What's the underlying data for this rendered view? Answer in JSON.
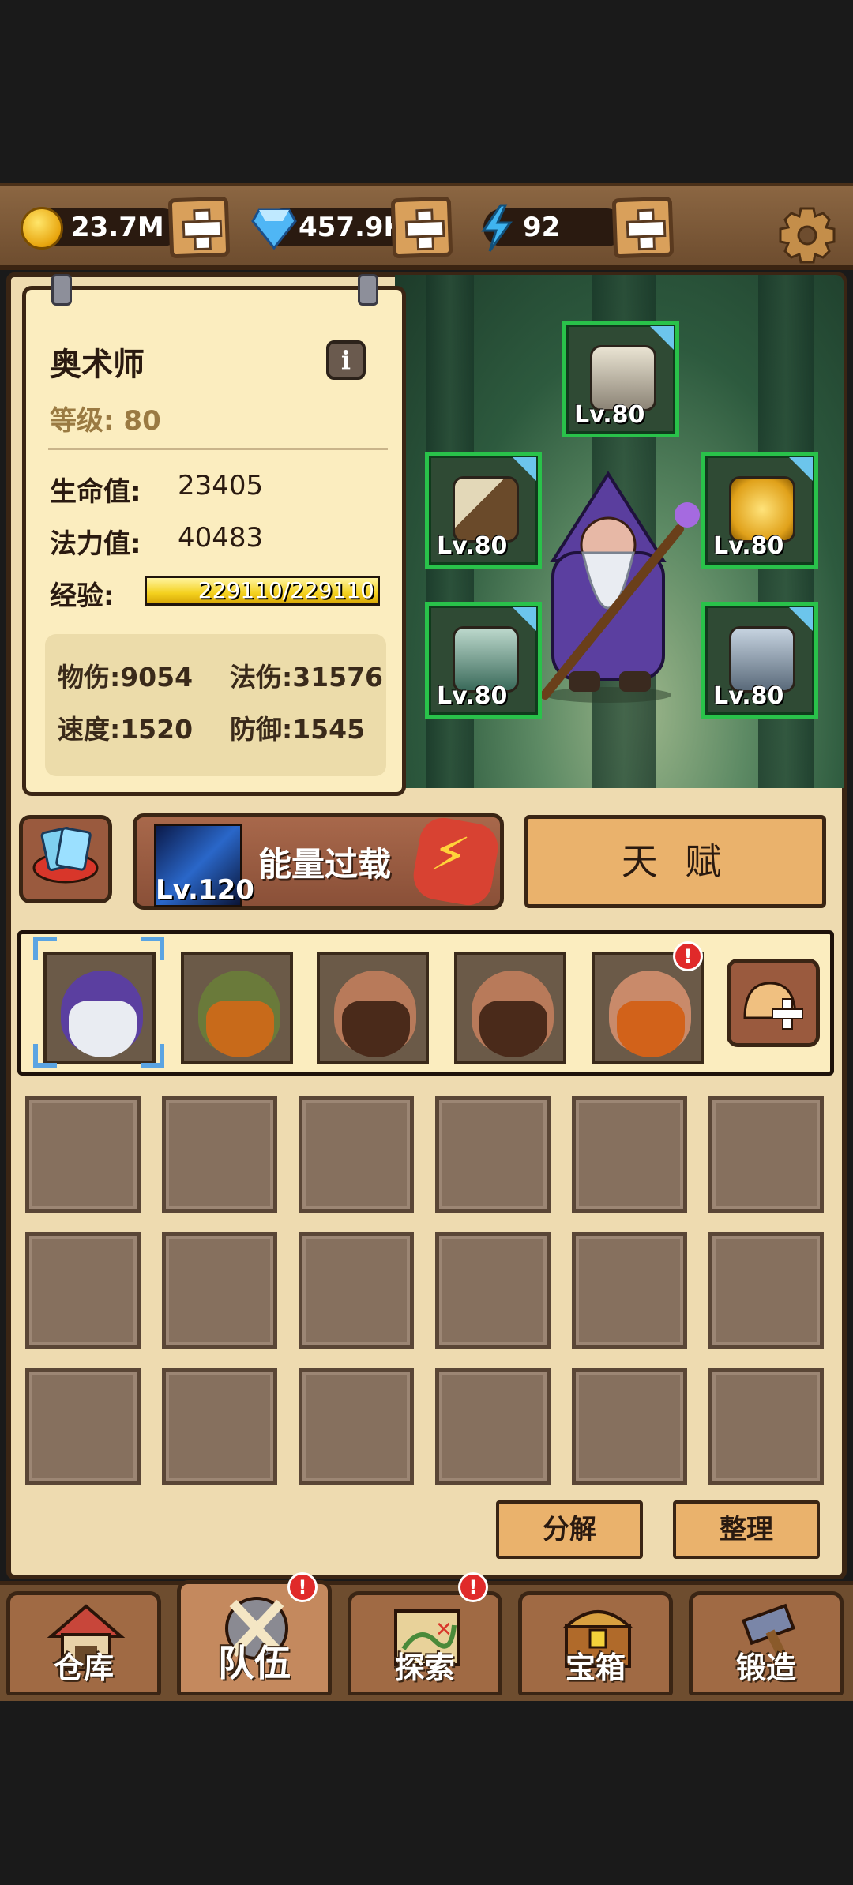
{
  "resources": {
    "gold": "23.7M",
    "diamond": "457.9K",
    "energy": "92"
  },
  "hero": {
    "name": "奥术师",
    "level_label": "等级: 80",
    "hp_label": "生命值:",
    "hp_value": "23405",
    "mp_label": "法力值:",
    "mp_value": "40483",
    "exp_label": "经验:",
    "exp_text": "229110/229110",
    "exp_fraction": 1.0,
    "physical_attack": "物伤:9054",
    "magic_attack": "法伤:31576",
    "speed": "速度:1520",
    "defense": "防御:1545"
  },
  "equipment": {
    "helmet": "Lv.80",
    "weapon": "Lv.80",
    "armor": "Lv.80",
    "gloves": "Lv.80",
    "boots": "Lv.80"
  },
  "skill": {
    "name": "能量过载",
    "level": "Lv.120"
  },
  "talent_label": "天 赋",
  "actions": {
    "decompose": "分解",
    "sort": "整理"
  },
  "nav": {
    "warehouse": "仓库",
    "team": "队伍",
    "explore": "探索",
    "chest": "宝箱",
    "forge": "锻造"
  },
  "badges": {
    "hero5": "!",
    "team": "!",
    "explore": "!"
  }
}
